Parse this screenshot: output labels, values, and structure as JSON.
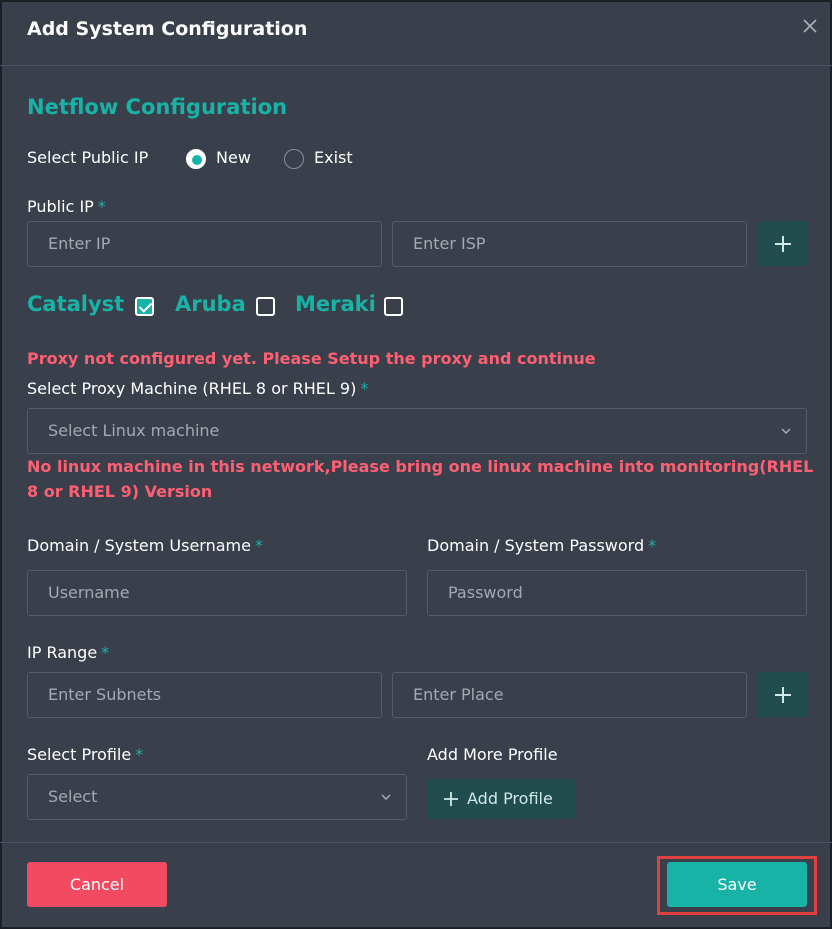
{
  "dialog": {
    "title": "Add System Configuration",
    "close_icon": "close-icon"
  },
  "netflow": {
    "section_title": "Netflow Configuration",
    "select_public_ip_label": "Select Public IP",
    "radio_options": [
      "New",
      "Exist"
    ],
    "selected_option": "New",
    "public_ip_label": "Public IP",
    "required_mark": "*",
    "ip_placeholder": "Enter IP",
    "isp_placeholder": "Enter ISP"
  },
  "vendors": [
    {
      "label": "Catalyst",
      "checked": true
    },
    {
      "label": "Aruba",
      "checked": false
    },
    {
      "label": "Meraki",
      "checked": false
    }
  ],
  "proxy": {
    "error_not_configured": "Proxy not configured yet. Please Setup the proxy and continue",
    "select_label": "Select Proxy Machine (RHEL 8 or RHEL 9)",
    "select_placeholder": "Select Linux machine",
    "error_no_linux_line1": "No linux machine in this network,Please bring one linux machine into monitoring(RHEL",
    "error_no_linux_line2": "8 or RHEL 9) Version"
  },
  "credentials": {
    "username_label": "Domain / System Username",
    "username_placeholder": "Username",
    "password_label": "Domain / System Password",
    "password_placeholder": "Password"
  },
  "ip_range": {
    "label": "IP Range",
    "subnets_placeholder": "Enter Subnets",
    "place_placeholder": "Enter Place"
  },
  "profile": {
    "select_label": "Select Profile",
    "select_value": "Select",
    "add_more_label": "Add More Profile",
    "add_button_label": "Add Profile"
  },
  "footer": {
    "cancel_label": "Cancel",
    "save_label": "Save"
  },
  "colors": {
    "accent": "#17b3a7",
    "error": "#ff5f72",
    "cancel": "#f24a60",
    "background": "#3a404b",
    "highlight": "#e0403e"
  }
}
